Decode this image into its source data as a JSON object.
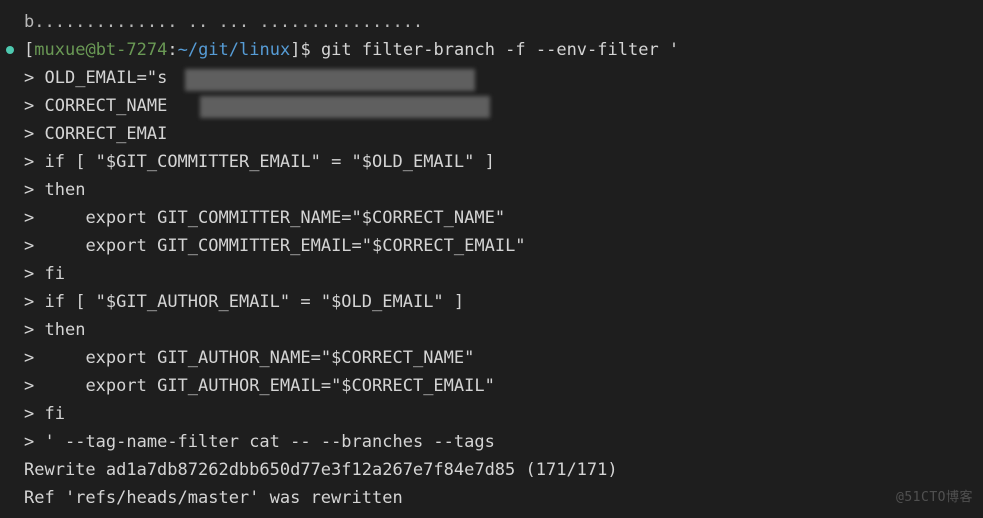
{
  "prompt": {
    "user": "muxue",
    "host": "bt-7274",
    "path": "~/git/linux",
    "symbol": "$",
    "command": "git filter-branch -f --env-filter '"
  },
  "top_partial": "b.............. .. ... ................",
  "continuation": ">",
  "lines": [
    "OLD_EMAIL=\"s",
    "CORRECT_NAME",
    "CORRECT_EMAI",
    "if [ \"$GIT_COMMITTER_EMAIL\" = \"$OLD_EMAIL\" ]",
    "then",
    "    export GIT_COMMITTER_NAME=\"$CORRECT_NAME\"",
    "    export GIT_COMMITTER_EMAIL=\"$CORRECT_EMAIL\"",
    "fi",
    "if [ \"$GIT_AUTHOR_EMAIL\" = \"$OLD_EMAIL\" ]",
    "then",
    "    export GIT_AUTHOR_NAME=\"$CORRECT_NAME\"",
    "    export GIT_AUTHOR_EMAIL=\"$CORRECT_EMAIL\"",
    "fi",
    "' --tag-name-filter cat -- --branches --tags"
  ],
  "output": [
    "Rewrite ad1a7db87262dbb650d77e3f12a267e7f84e7d85 (171/171)",
    "Ref 'refs/heads/master' was rewritten"
  ],
  "watermark": "@51CTO博客"
}
